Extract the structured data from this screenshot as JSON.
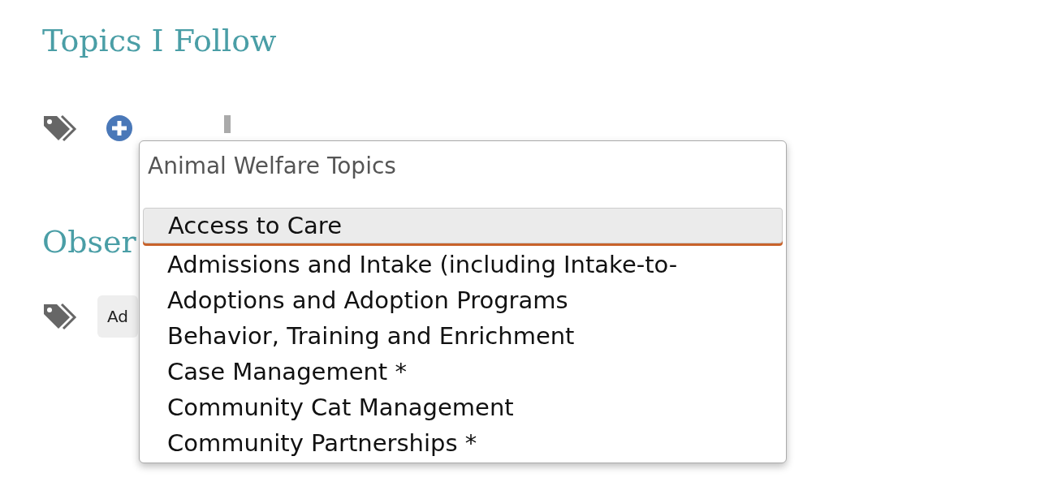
{
  "sections": [
    {
      "heading": "Topics I Follow"
    },
    {
      "heading": "Obser",
      "tags": [
        "Ad"
      ]
    }
  ],
  "dropdown": {
    "title": "Animal Welfare Topics",
    "items": [
      {
        "label": "Access to Care",
        "selected": true
      },
      {
        "label": "Admissions and Intake (including Intake-to-",
        "selected": false
      },
      {
        "label": "Adoptions and Adoption Programs",
        "selected": false
      },
      {
        "label": "Behavior, Training and Enrichment",
        "selected": false
      },
      {
        "label": "Case Management *",
        "selected": false
      },
      {
        "label": "Community Cat Management",
        "selected": false
      },
      {
        "label": "Community Partnerships *",
        "selected": false
      }
    ]
  }
}
